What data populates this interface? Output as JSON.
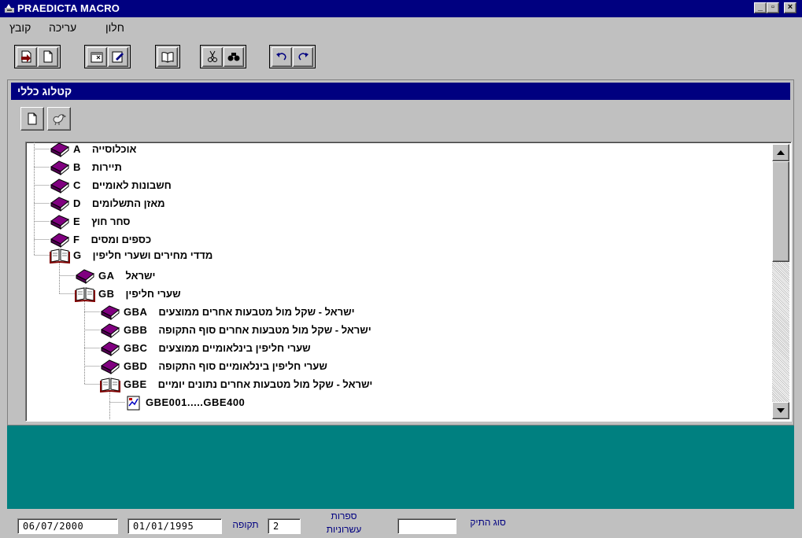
{
  "window": {
    "title": "PRAEDICTA MACRO",
    "controls": {
      "minimize": "_",
      "maximize": "▫",
      "close": "×"
    }
  },
  "menu": {
    "items": [
      {
        "label": "קובץ"
      },
      {
        "label": "עריכה"
      },
      {
        "label": "חלון"
      }
    ]
  },
  "toolbar": {
    "icons": [
      "new-catalog-icon",
      "new-document-icon",
      "properties-icon",
      "edit-icon",
      "book-icon",
      "cut-icon",
      "find-icon",
      "undo-icon",
      "redo-icon"
    ]
  },
  "catalog": {
    "title": "קטלוג כללי",
    "toolbar_icons": [
      "new-document-icon",
      "duck-icon"
    ]
  },
  "tree": {
    "items": [
      {
        "code": "A",
        "label": "אוכלוסייה",
        "icon": "closed-book-icon",
        "expanded": false
      },
      {
        "code": "B",
        "label": "תיירות",
        "icon": "closed-book-icon",
        "expanded": false
      },
      {
        "code": "C",
        "label": "חשבונות לאומיים",
        "icon": "closed-book-icon",
        "expanded": false
      },
      {
        "code": "D",
        "label": "מאזן התשלומים",
        "icon": "closed-book-icon",
        "expanded": false
      },
      {
        "code": "E",
        "label": "סחר חוץ",
        "icon": "closed-book-icon",
        "expanded": false
      },
      {
        "code": "F",
        "label": "כספים ומסים",
        "icon": "closed-book-icon",
        "expanded": false
      },
      {
        "code": "G",
        "label": "מדדי מחירים ושערי חליפין",
        "icon": "open-book-icon",
        "expanded": true
      },
      {
        "code": "GA",
        "label": "ישראל",
        "icon": "closed-book-icon",
        "expanded": false
      },
      {
        "code": "GB",
        "label": "שערי חליפין",
        "icon": "open-book-icon",
        "expanded": true
      },
      {
        "code": "GBA",
        "label": "ישראל - שקל מול מטבעות אחרים ממוצעים",
        "icon": "closed-book-icon",
        "expanded": false
      },
      {
        "code": "GBB",
        "label": "ישראל - שקל מול מטבעות אחרים סוף התקופה",
        "icon": "closed-book-icon",
        "expanded": false
      },
      {
        "code": "GBC",
        "label": "שערי חליפין בינלאומיים ממוצעים",
        "icon": "closed-book-icon",
        "expanded": false
      },
      {
        "code": "GBD",
        "label": "שערי חליפין בינלאומיים סוף התקופה",
        "icon": "closed-book-icon",
        "expanded": false
      },
      {
        "code": "GBE",
        "label": "ישראל - שקל מול מטבעות אחרים נתונים יומיים",
        "icon": "open-book-icon",
        "expanded": true
      },
      {
        "code": "GBE001.....GBE400",
        "label": "",
        "icon": "series-file-icon",
        "expanded": false
      }
    ]
  },
  "status": {
    "end_date": "06/07/2000",
    "start_date": "01/01/1995",
    "period_label": "תקופה",
    "decimals_value": "2",
    "decimals_label_line1": "ספרות",
    "decimals_label_line2": "עשרוניות",
    "file_type_value": "",
    "file_type_label": "סוג התיק"
  }
}
